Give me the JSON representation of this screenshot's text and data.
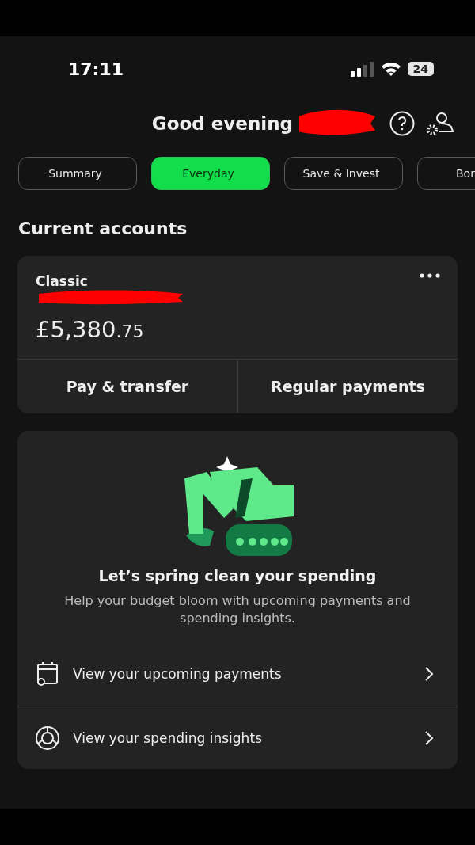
{
  "status_bar": {
    "time": "17:11",
    "battery": "24"
  },
  "header": {
    "greeting": "Good evening"
  },
  "tabs": [
    {
      "label": "Summary",
      "selected": false
    },
    {
      "label": "Everyday",
      "selected": true
    },
    {
      "label": "Save & Invest",
      "selected": false
    },
    {
      "label": "Bor",
      "selected": false
    }
  ],
  "section_title": "Current accounts",
  "account": {
    "name": "Classic",
    "balance_main": "£5,380",
    "balance_pence": ".75",
    "actions": [
      "Pay & transfer",
      "Regular payments"
    ]
  },
  "promo": {
    "title": "Let’s spring clean your spending",
    "body": "Help your budget bloom with upcoming payments and spending insights.",
    "links": [
      {
        "kind": "calendar",
        "label": "View your upcoming payments"
      },
      {
        "kind": "insights",
        "label": "View your spending insights"
      }
    ]
  }
}
